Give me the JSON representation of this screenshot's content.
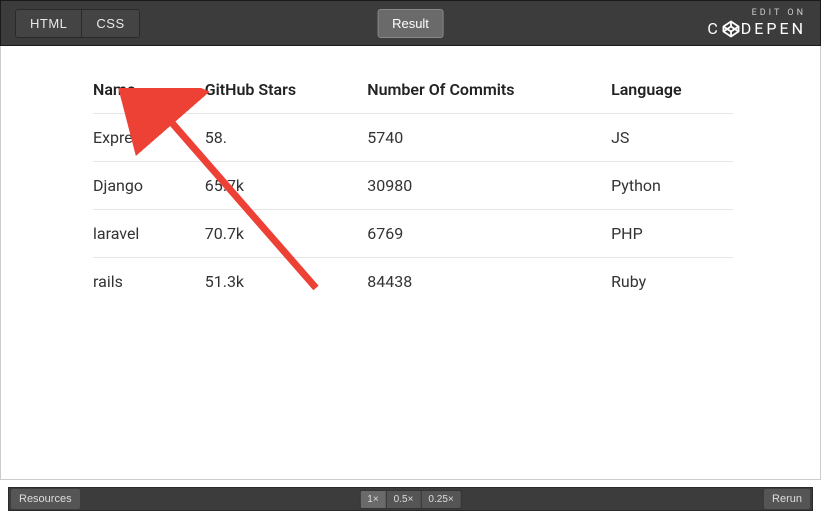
{
  "topbar": {
    "html_tab": "HTML",
    "css_tab": "CSS",
    "result_tab": "Result",
    "edit_on": "EDIT ON",
    "brand_before": "C",
    "brand_after": "DEPEN"
  },
  "table": {
    "headers": {
      "name": "Name",
      "stars": "GitHub Stars",
      "commits": "Number Of Commits",
      "language": "Language"
    },
    "rows": [
      {
        "name": "Express",
        "stars": "58.",
        "commits": "5740",
        "language": "JS"
      },
      {
        "name": "Django",
        "stars": "65.7k",
        "commits": "30980",
        "language": "Python"
      },
      {
        "name": "laravel",
        "stars": "70.7k",
        "commits": "6769",
        "language": "PHP"
      },
      {
        "name": "rails",
        "stars": "51.3k",
        "commits": "84438",
        "language": "Ruby"
      }
    ]
  },
  "bottombar": {
    "resources": "Resources",
    "zoom": [
      "1×",
      "0.5×",
      "0.25×"
    ],
    "rerun": "Rerun"
  },
  "annotation": {
    "arrow_color": "#ed4136"
  }
}
